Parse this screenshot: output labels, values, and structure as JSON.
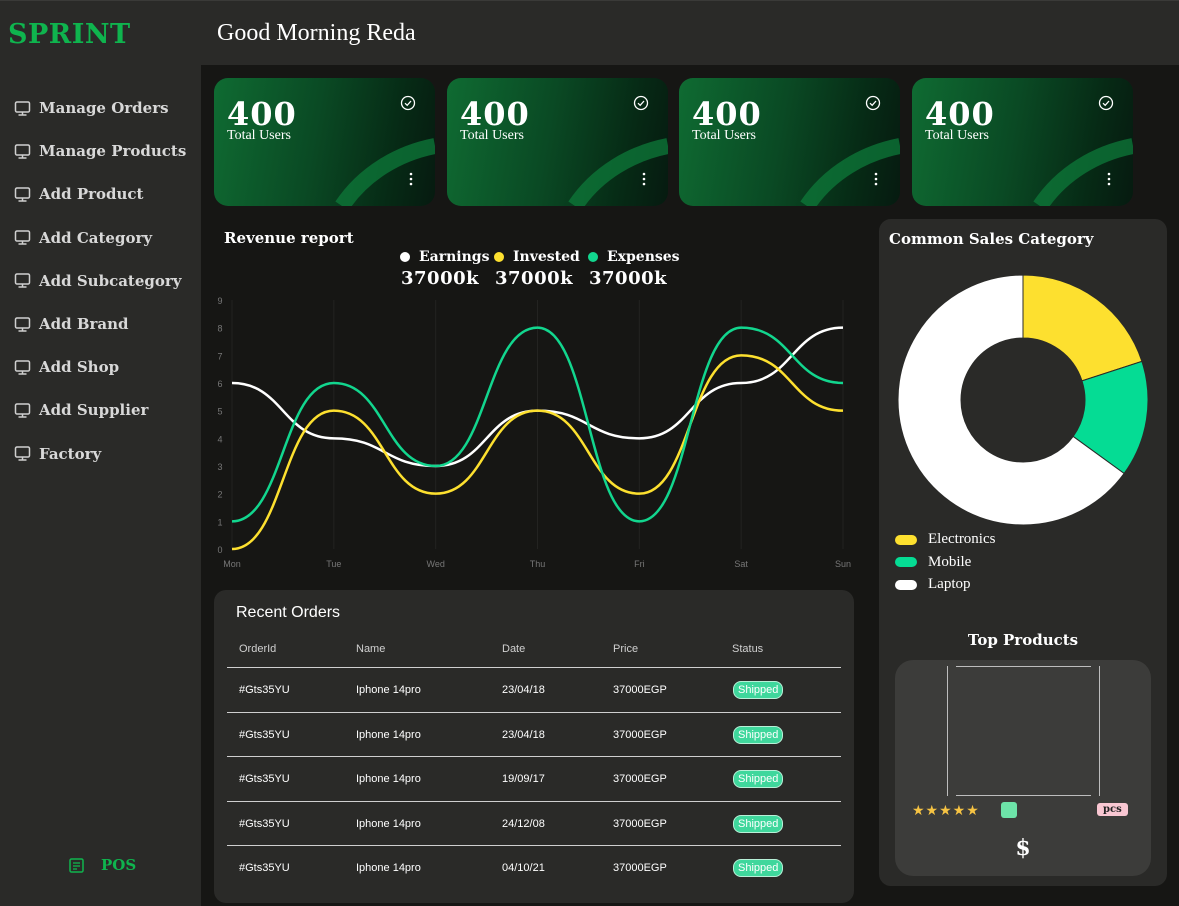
{
  "app": {
    "logo": "SPRINT",
    "greeting": "Good Morning Reda"
  },
  "sidebar": {
    "items": [
      {
        "label": "Manage Orders",
        "icon": "monitor-icon"
      },
      {
        "label": "Manage Products",
        "icon": "monitor-icon"
      },
      {
        "label": "Add Product",
        "icon": "monitor-icon"
      },
      {
        "label": "Add Category",
        "icon": "monitor-icon"
      },
      {
        "label": "Add Subcategory",
        "icon": "monitor-icon"
      },
      {
        "label": "Add Brand",
        "icon": "monitor-icon"
      },
      {
        "label": "Add Shop",
        "icon": "monitor-icon"
      },
      {
        "label": "Add Supplier",
        "icon": "monitor-icon"
      },
      {
        "label": "Factory",
        "icon": "monitor-icon"
      }
    ],
    "pos": {
      "label": "POS",
      "icon": "receipt-icon"
    }
  },
  "stats": [
    {
      "value": "400",
      "label": "Total Users"
    },
    {
      "value": "400",
      "label": "Total Users"
    },
    {
      "value": "400",
      "label": "Total Users"
    },
    {
      "value": "400",
      "label": "Total Users"
    }
  ],
  "revenue": {
    "title": "Revenue report",
    "legend": [
      {
        "name": "Earnings",
        "value": "37000k",
        "color": "#ffffff"
      },
      {
        "name": "Invested",
        "value": "37000k",
        "color": "#fde02f"
      },
      {
        "name": "Expenses",
        "value": "37000k",
        "color": "#12d68e"
      }
    ]
  },
  "chart_data": {
    "type": "line",
    "title": "",
    "categories": [
      "Mon",
      "Tue",
      "Wed",
      "Thu",
      "Fri",
      "Sat",
      "Sun"
    ],
    "series": [
      {
        "name": "Earnings",
        "color": "#ffffff",
        "values": [
          6,
          4,
          3,
          5,
          4,
          6,
          8
        ]
      },
      {
        "name": "Invested",
        "color": "#fde02f",
        "values": [
          0,
          5,
          2,
          5,
          2,
          7,
          5
        ]
      },
      {
        "name": "Expenses",
        "color": "#12d68e",
        "values": [
          1,
          6,
          3,
          8,
          1,
          8,
          6
        ]
      }
    ],
    "yticks": [
      "0",
      "1",
      "2",
      "3",
      "4",
      "5",
      "6",
      "7",
      "8",
      "9"
    ],
    "ylim": [
      0,
      9
    ],
    "grid": false
  },
  "orders": {
    "title": "Recent Orders",
    "columns": [
      "OrderId",
      "Name",
      "Date",
      "Price",
      "Status"
    ],
    "rows": [
      [
        "#Gts35YU",
        "Iphone 14pro",
        "23/04/18",
        "37000EGP",
        "Shipped"
      ],
      [
        "#Gts35YU",
        "Iphone 14pro",
        "23/04/18",
        "37000EGP",
        "Shipped"
      ],
      [
        "#Gts35YU",
        "Iphone 14pro",
        "19/09/17",
        "37000EGP",
        "Shipped"
      ],
      [
        "#Gts35YU",
        "Iphone 14pro",
        "24/12/08",
        "37000EGP",
        "Shipped"
      ],
      [
        "#Gts35YU",
        "Iphone 14pro",
        "04/10/21",
        "37000EGP",
        "Shipped"
      ]
    ]
  },
  "sales_category": {
    "title": "Common Sales Category",
    "items": [
      {
        "name": "Electronics",
        "color": "#fde02f",
        "share": 0.2
      },
      {
        "name": "Mobile",
        "color": "#05dc94",
        "share": 0.15
      },
      {
        "name": "Laptop",
        "color": "#ffffff",
        "share": 0.65
      }
    ]
  },
  "top_products": {
    "title": "Top Products",
    "rating": "★★★★★",
    "unit": "pcs",
    "price": "$"
  }
}
